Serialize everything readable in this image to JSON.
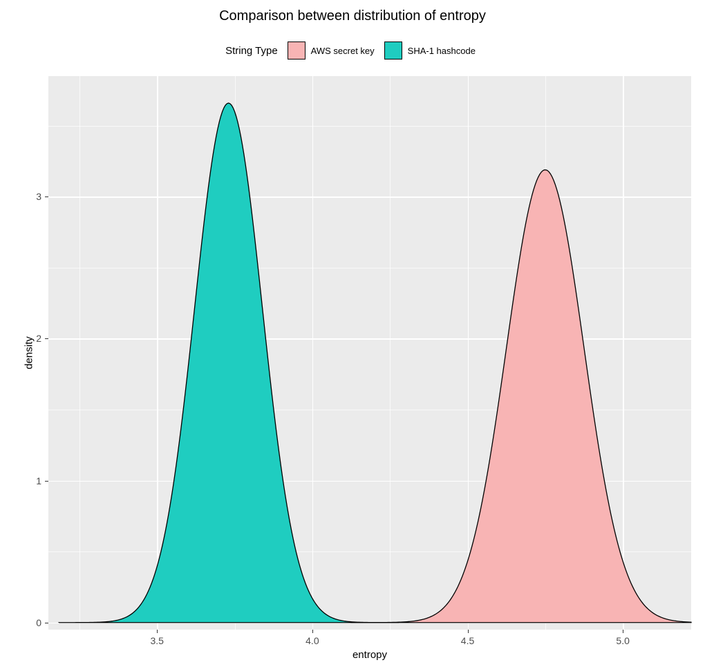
{
  "chart_data": {
    "type": "area",
    "title": "Comparison between distribution of entropy",
    "xlabel": "entropy",
    "ylabel": "density",
    "xlim": [
      3.15,
      5.22
    ],
    "ylim": [
      -0.05,
      3.85
    ],
    "x_ticks": [
      3.5,
      4.0,
      4.5,
      5.0
    ],
    "y_ticks": [
      0,
      1,
      2,
      3
    ],
    "x_minor": [
      3.25,
      3.75,
      4.25,
      4.75
    ],
    "y_minor": [
      0.5,
      1.5,
      2.5,
      3.5
    ],
    "legend_title": "String Type",
    "series": [
      {
        "name": "AWS secret key",
        "color": "#F8B4B4",
        "mean": 4.75,
        "sd": 0.125,
        "peak": 3.19
      },
      {
        "name": "SHA-1 hashcode",
        "color": "#1FCDC0",
        "mean": 3.73,
        "sd": 0.109,
        "peak": 3.66
      }
    ]
  }
}
